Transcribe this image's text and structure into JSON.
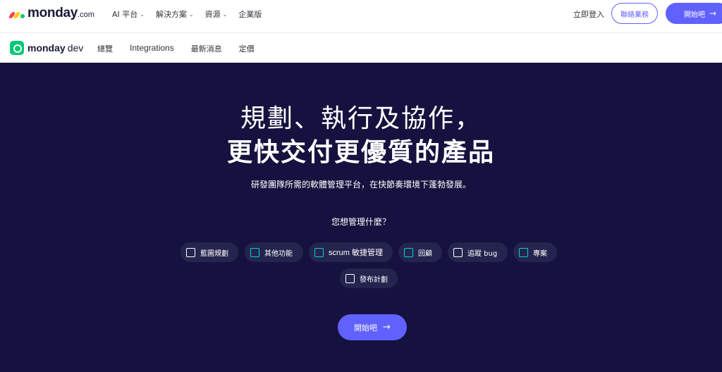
{
  "brand": {
    "name": "monday",
    "suffix": ".com"
  },
  "top_menu": [
    {
      "label": "AI 平台",
      "has_dropdown": true
    },
    {
      "label": "解決方案",
      "has_dropdown": true
    },
    {
      "label": "資源",
      "has_dropdown": true
    },
    {
      "label": "企業版",
      "has_dropdown": false
    }
  ],
  "top_actions": {
    "login": "立即登入",
    "contact": "聯絡業務",
    "start": "開始吧"
  },
  "product": {
    "brand": "monday",
    "suffix": "dev"
  },
  "sub_menu": [
    "總覽",
    "Integrations",
    "最新消息",
    "定價"
  ],
  "hero": {
    "headline_line1": "規劃、執行及協作，",
    "headline_line2": "更快交付更優質的產品",
    "subtitle": "研發團隊所需的軟體管理平台，在快節奏環境下蓬勃發展。",
    "question": "您想管理什麼？",
    "options": [
      {
        "label": "藍圖規劃",
        "checked": false
      },
      {
        "label": "其他功能",
        "checked": false
      },
      {
        "label": "scrum 敏捷管理",
        "checked": false
      },
      {
        "label": "回顧",
        "checked": false
      },
      {
        "label": "追蹤 bug",
        "checked": false
      },
      {
        "label": "專案",
        "checked": false
      },
      {
        "label": "發布計劃",
        "checked": false
      }
    ],
    "cta": "開始吧"
  },
  "colors": {
    "accent": "#6161ff",
    "hero_bg": "#16123f",
    "chip_bg": "#25244f",
    "dev_green": "#00c875"
  }
}
